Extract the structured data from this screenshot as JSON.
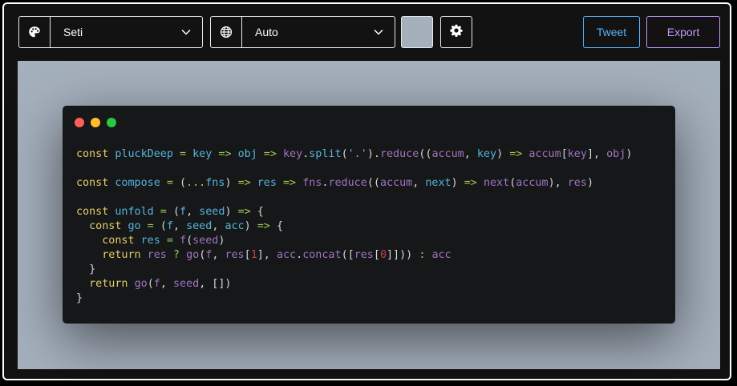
{
  "toolbar": {
    "theme": {
      "icon": "palette-icon",
      "value": "Seti"
    },
    "language": {
      "icon": "globe-icon",
      "value": "Auto"
    },
    "background_color": "#a5b0bd",
    "settings_icon": "gear-icon",
    "tweet_label": "Tweet",
    "export_label": "Export",
    "tweet_color": "#57b5f9",
    "export_color": "#c198fb"
  },
  "editor": {
    "window_controls": [
      {
        "name": "close",
        "color": "#ff5f56"
      },
      {
        "name": "minimize",
        "color": "#ffbd2e"
      },
      {
        "name": "maximize",
        "color": "#27c93f"
      }
    ],
    "code_lines": [
      [
        [
          "kw",
          "const "
        ],
        [
          "var",
          "pluckDeep"
        ],
        [
          "op",
          " = "
        ],
        [
          "var",
          "key"
        ],
        [
          "op",
          " => "
        ],
        [
          "var",
          "obj"
        ],
        [
          "op",
          " => "
        ],
        [
          "fn",
          "key"
        ],
        [
          "pl",
          "."
        ],
        [
          "var",
          "split"
        ],
        [
          "pl",
          "("
        ],
        [
          "str",
          "'.'"
        ],
        [
          "pl",
          ")."
        ],
        [
          "fn",
          "reduce"
        ],
        [
          "pl",
          "(("
        ],
        [
          "fn",
          "accum"
        ],
        [
          "pl",
          ", "
        ],
        [
          "var",
          "key"
        ],
        [
          "pl",
          ") "
        ],
        [
          "op",
          "=> "
        ],
        [
          "fn",
          "accum"
        ],
        [
          "pl",
          "["
        ],
        [
          "fn",
          "key"
        ],
        [
          "pl",
          "], "
        ],
        [
          "fn",
          "obj"
        ],
        [
          "pl",
          ")"
        ]
      ],
      [],
      [
        [
          "kw",
          "const "
        ],
        [
          "var",
          "compose"
        ],
        [
          "op",
          " = "
        ],
        [
          "pl",
          "("
        ],
        [
          "op",
          "..."
        ],
        [
          "var",
          "fns"
        ],
        [
          "pl",
          ") "
        ],
        [
          "op",
          "=> "
        ],
        [
          "var",
          "res"
        ],
        [
          "op",
          " => "
        ],
        [
          "fn",
          "fns"
        ],
        [
          "pl",
          "."
        ],
        [
          "fn",
          "reduce"
        ],
        [
          "pl",
          "(("
        ],
        [
          "fn",
          "accum"
        ],
        [
          "pl",
          ", "
        ],
        [
          "var",
          "next"
        ],
        [
          "pl",
          ") "
        ],
        [
          "op",
          "=> "
        ],
        [
          "fn",
          "next"
        ],
        [
          "pl",
          "("
        ],
        [
          "fn",
          "accum"
        ],
        [
          "pl",
          "), "
        ],
        [
          "fn",
          "res"
        ],
        [
          "pl",
          ")"
        ]
      ],
      [],
      [
        [
          "kw",
          "const "
        ],
        [
          "var",
          "unfold"
        ],
        [
          "op",
          " = "
        ],
        [
          "pl",
          "("
        ],
        [
          "var",
          "f"
        ],
        [
          "pl",
          ", "
        ],
        [
          "var",
          "seed"
        ],
        [
          "pl",
          ") "
        ],
        [
          "op",
          "=> "
        ],
        [
          "pl",
          "{"
        ]
      ],
      [
        [
          "pl",
          "  "
        ],
        [
          "kw",
          "const "
        ],
        [
          "var",
          "go"
        ],
        [
          "op",
          " = "
        ],
        [
          "pl",
          "("
        ],
        [
          "var",
          "f"
        ],
        [
          "pl",
          ", "
        ],
        [
          "var",
          "seed"
        ],
        [
          "pl",
          ", "
        ],
        [
          "var",
          "acc"
        ],
        [
          "pl",
          ") "
        ],
        [
          "op",
          "=> "
        ],
        [
          "pl",
          "{"
        ]
      ],
      [
        [
          "pl",
          "    "
        ],
        [
          "kw",
          "const "
        ],
        [
          "var",
          "res"
        ],
        [
          "op",
          " = "
        ],
        [
          "fn",
          "f"
        ],
        [
          "pl",
          "("
        ],
        [
          "fn",
          "seed"
        ],
        [
          "pl",
          ")"
        ]
      ],
      [
        [
          "pl",
          "    "
        ],
        [
          "kw",
          "return "
        ],
        [
          "fn",
          "res"
        ],
        [
          "op",
          " ? "
        ],
        [
          "fn",
          "go"
        ],
        [
          "pl",
          "("
        ],
        [
          "fn",
          "f"
        ],
        [
          "pl",
          ", "
        ],
        [
          "fn",
          "res"
        ],
        [
          "pl",
          "["
        ],
        [
          "num",
          "1"
        ],
        [
          "pl",
          "], "
        ],
        [
          "fn",
          "acc"
        ],
        [
          "pl",
          "."
        ],
        [
          "fn",
          "concat"
        ],
        [
          "pl",
          "(["
        ],
        [
          "fn",
          "res"
        ],
        [
          "pl",
          "["
        ],
        [
          "num",
          "0"
        ],
        [
          "pl",
          "]])) "
        ],
        [
          "op",
          ": "
        ],
        [
          "fn",
          "acc"
        ]
      ],
      [
        [
          "pl",
          "  }"
        ]
      ],
      [
        [
          "pl",
          "  "
        ],
        [
          "kw",
          "return "
        ],
        [
          "fn",
          "go"
        ],
        [
          "pl",
          "("
        ],
        [
          "fn",
          "f"
        ],
        [
          "pl",
          ", "
        ],
        [
          "fn",
          "seed"
        ],
        [
          "pl",
          ", [])"
        ]
      ],
      [
        [
          "pl",
          "}"
        ]
      ]
    ]
  }
}
